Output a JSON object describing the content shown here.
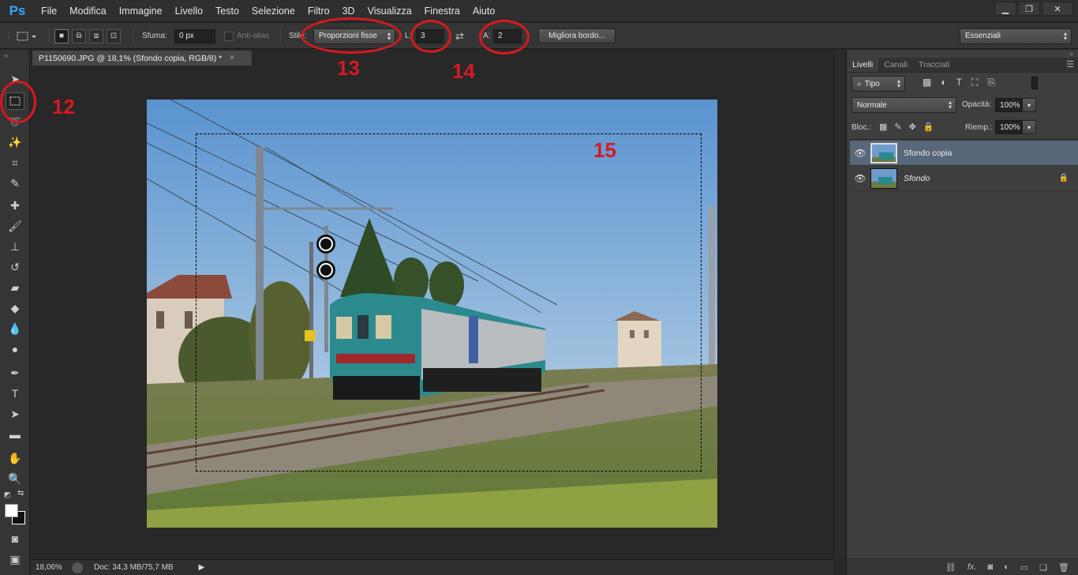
{
  "app": {
    "logo": "Ps",
    "menu": [
      "File",
      "Modifica",
      "Immagine",
      "Livello",
      "Testo",
      "Selezione",
      "Filtro",
      "3D",
      "Visualizza",
      "Finestra",
      "Aiuto"
    ],
    "window_controls": [
      "minimize-icon",
      "restore-icon",
      "close-icon"
    ]
  },
  "options_bar": {
    "feather_label": "Sfuma:",
    "feather_value": "0 px",
    "antialias_label": "Anti-alias",
    "style_label": "Stile:",
    "style_value": "Proporzioni fisse",
    "width_label": "L:",
    "width_value": "3",
    "height_label": "A:",
    "height_value": "2",
    "refine_button": "Migliora bordo...",
    "workspace_value": "Essenziali"
  },
  "document": {
    "tab_title": "P1150690.JPG @ 18,1% (Sfondo copia, RGB/8) *",
    "close_glyph": "×",
    "zoom": "18,06%",
    "doc_info": "Doc: 34,3 MB/75,7 MB",
    "photo_palette": {
      "sky_top": "#5a93d0",
      "sky_bottom": "#aac8e2",
      "ground": "#6d7a45",
      "train": "#2b8a8e"
    }
  },
  "annotations": {
    "n12": "12",
    "n13": "13",
    "n14": "14",
    "n15": "15",
    "color": "#d71920"
  },
  "layers_panel": {
    "tabs": [
      "Livelli",
      "Canali",
      "Tracciati"
    ],
    "filter_value": "Tipo",
    "blend_mode": "Normale",
    "opacity_label": "Opacità:",
    "opacity_value": "100%",
    "lock_label": "Bloc.:",
    "fill_label": "Riemp.:",
    "fill_value": "100%",
    "layers": [
      {
        "name": "Sfondo copia",
        "selected": true,
        "locked": false
      },
      {
        "name": "Sfondo",
        "selected": false,
        "locked": true
      }
    ],
    "footer_icons": [
      "link-icon",
      "fx-icon",
      "mask-icon",
      "adjustment-icon",
      "folder-icon",
      "new-layer-icon",
      "trash-icon"
    ],
    "footer_fx": "fx."
  }
}
